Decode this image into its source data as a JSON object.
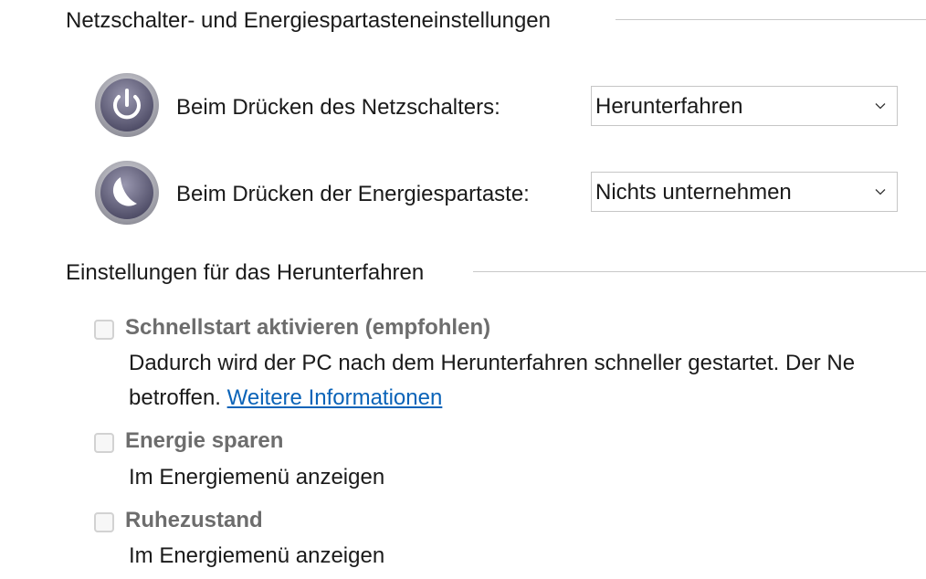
{
  "power_buttons_section": {
    "header": "Netzschalter- und Energiespartasteneinstellungen",
    "rows": [
      {
        "icon": "power-icon",
        "label": "Beim Drücken des Netzschalters:",
        "selected": "Herunterfahren"
      },
      {
        "icon": "sleep-icon",
        "label": "Beim Drücken der Energiespartaste:",
        "selected": "Nichts unternehmen"
      }
    ]
  },
  "shutdown_section": {
    "header": "Einstellungen für das Herunterfahren",
    "options": [
      {
        "title": "Schnellstart aktivieren (empfohlen)",
        "checked": false,
        "desc_line1": "Dadurch wird der PC nach dem Herunterfahren schneller gestartet. Der Ne",
        "desc_line2": "betroffen.",
        "link": "Weitere Informationen"
      },
      {
        "title": "Energie sparen",
        "checked": false,
        "desc": "Im Energiemenü anzeigen"
      },
      {
        "title": "Ruhezustand",
        "checked": false,
        "desc": "Im Energiemenü anzeigen"
      }
    ]
  },
  "colors": {
    "link": "#0a63b8",
    "disabled_title": "#6d6d6d",
    "divider": "#c8c8c8"
  }
}
